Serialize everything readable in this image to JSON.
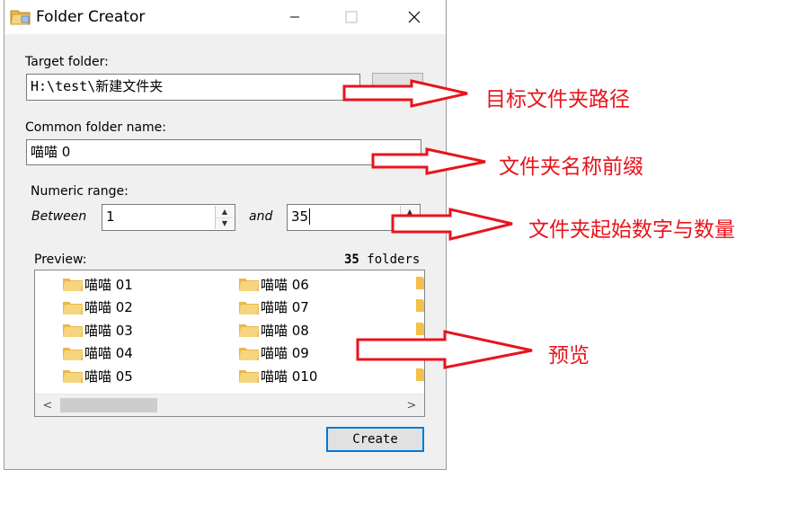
{
  "window": {
    "title": "Folder Creator",
    "icon": "folder-app-icon",
    "controls": [
      "minimize-icon",
      "maximize-icon",
      "close-icon"
    ]
  },
  "form": {
    "target_label": "Target folder:",
    "target_value": "H:\\test\\新建文件夹",
    "common_label": "Common folder name:",
    "common_value": "喵喵 0",
    "numeric_label": "Numeric range:",
    "between_label": "Between",
    "from_value": "1",
    "and_label": "and",
    "to_value": "35"
  },
  "preview": {
    "label": "Preview:",
    "count_number": "35",
    "count_unit": "folders",
    "items_col1": [
      "喵喵 01",
      "喵喵 02",
      "喵喵 03",
      "喵喵 04",
      "喵喵 05"
    ],
    "items_col2": [
      "喵喵 06",
      "喵喵 07",
      "喵喵 08",
      "喵喵 09",
      "喵喵 010"
    ]
  },
  "buttons": {
    "create": "Create"
  },
  "annotations": {
    "target": "目标文件夹路径",
    "prefix": "文件夹名称前缀",
    "range": "文件夹起始数字与数量",
    "preview": "预览"
  },
  "colors": {
    "annotation": "#e8141c",
    "focus_border": "#0078d7",
    "folder": "#f5c04a"
  }
}
